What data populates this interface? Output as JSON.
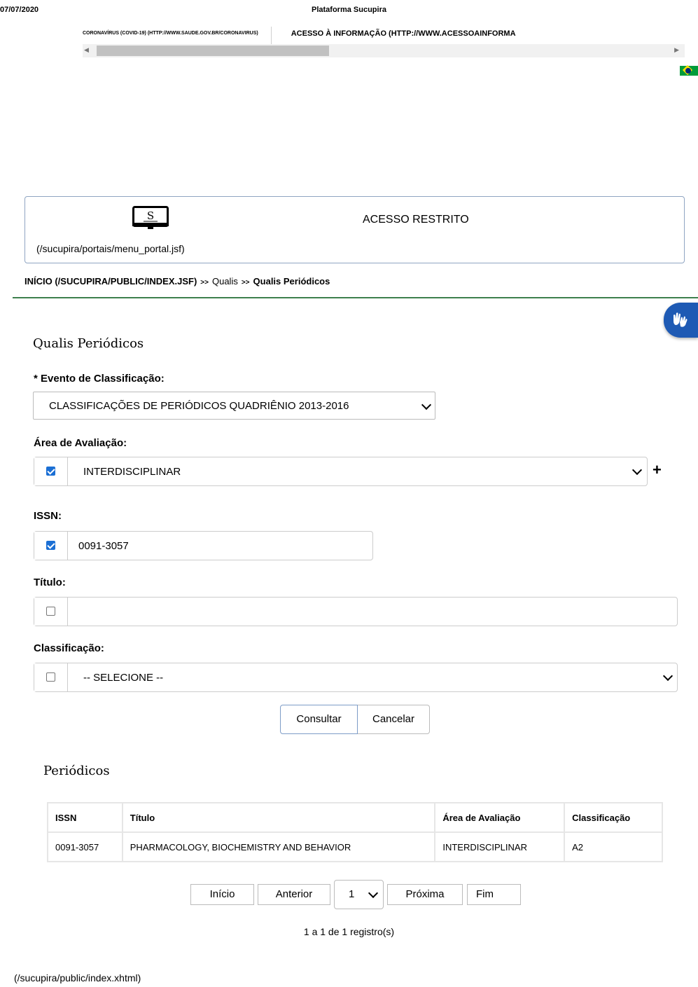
{
  "header": {
    "date": "07/07/2020",
    "title": "Plataforma Sucupira"
  },
  "gov_bar": {
    "link_covid": "CORONAVÍRUS (COVID-19) (HTTP://WWW.SAUDE.GOV.BR/CORONAVIRUS)",
    "link_acesso": "ACESSO À INFORMAÇÃO (HTTP://WWW.ACESSOAINFORMA"
  },
  "restricted": {
    "portal_link": "(/sucupira/portais/menu_portal.jsf)",
    "label": "ACESSO RESTRITO"
  },
  "breadcrumb": {
    "home": "INÍCIO (/SUCUPIRA/PUBLIC/INDEX.JSF)",
    "separator": ">>",
    "section": "Qualis",
    "current": "Qualis Periódicos"
  },
  "form": {
    "title": "Qualis Periódicos",
    "evento": {
      "label": "* Evento de Classificação:",
      "value": "CLASSIFICAÇÕES DE PERIÓDICOS QUADRIÊNIO 2013-2016"
    },
    "area": {
      "label": "Área de Avaliação:",
      "value": "INTERDISCIPLINAR",
      "checked": true,
      "add_symbol": "+"
    },
    "issn": {
      "label": "ISSN:",
      "value": "0091-3057",
      "checked": true
    },
    "titulo": {
      "label": "Título:",
      "value": "",
      "checked": false
    },
    "classificacao": {
      "label": "Classificação:",
      "value": "-- SELECIONE --",
      "checked": false
    },
    "buttons": {
      "consultar": "Consultar",
      "cancelar": "Cancelar"
    }
  },
  "results": {
    "title": "Periódicos",
    "columns": [
      "ISSN",
      "Título",
      "Área de Avaliação",
      "Classificação"
    ],
    "rows": [
      [
        "0091-3057",
        "PHARMACOLOGY, BIOCHEMISTRY AND BEHAVIOR",
        "INTERDISCIPLINAR",
        "A2"
      ]
    ]
  },
  "pagination": {
    "first": "Início",
    "prev": "Anterior",
    "page": "1",
    "next": "Próxima",
    "last": "Fim",
    "count": "1 a 1 de 1 registro(s)"
  },
  "footer": {
    "link": "(/sucupira/public/index.xhtml)"
  }
}
